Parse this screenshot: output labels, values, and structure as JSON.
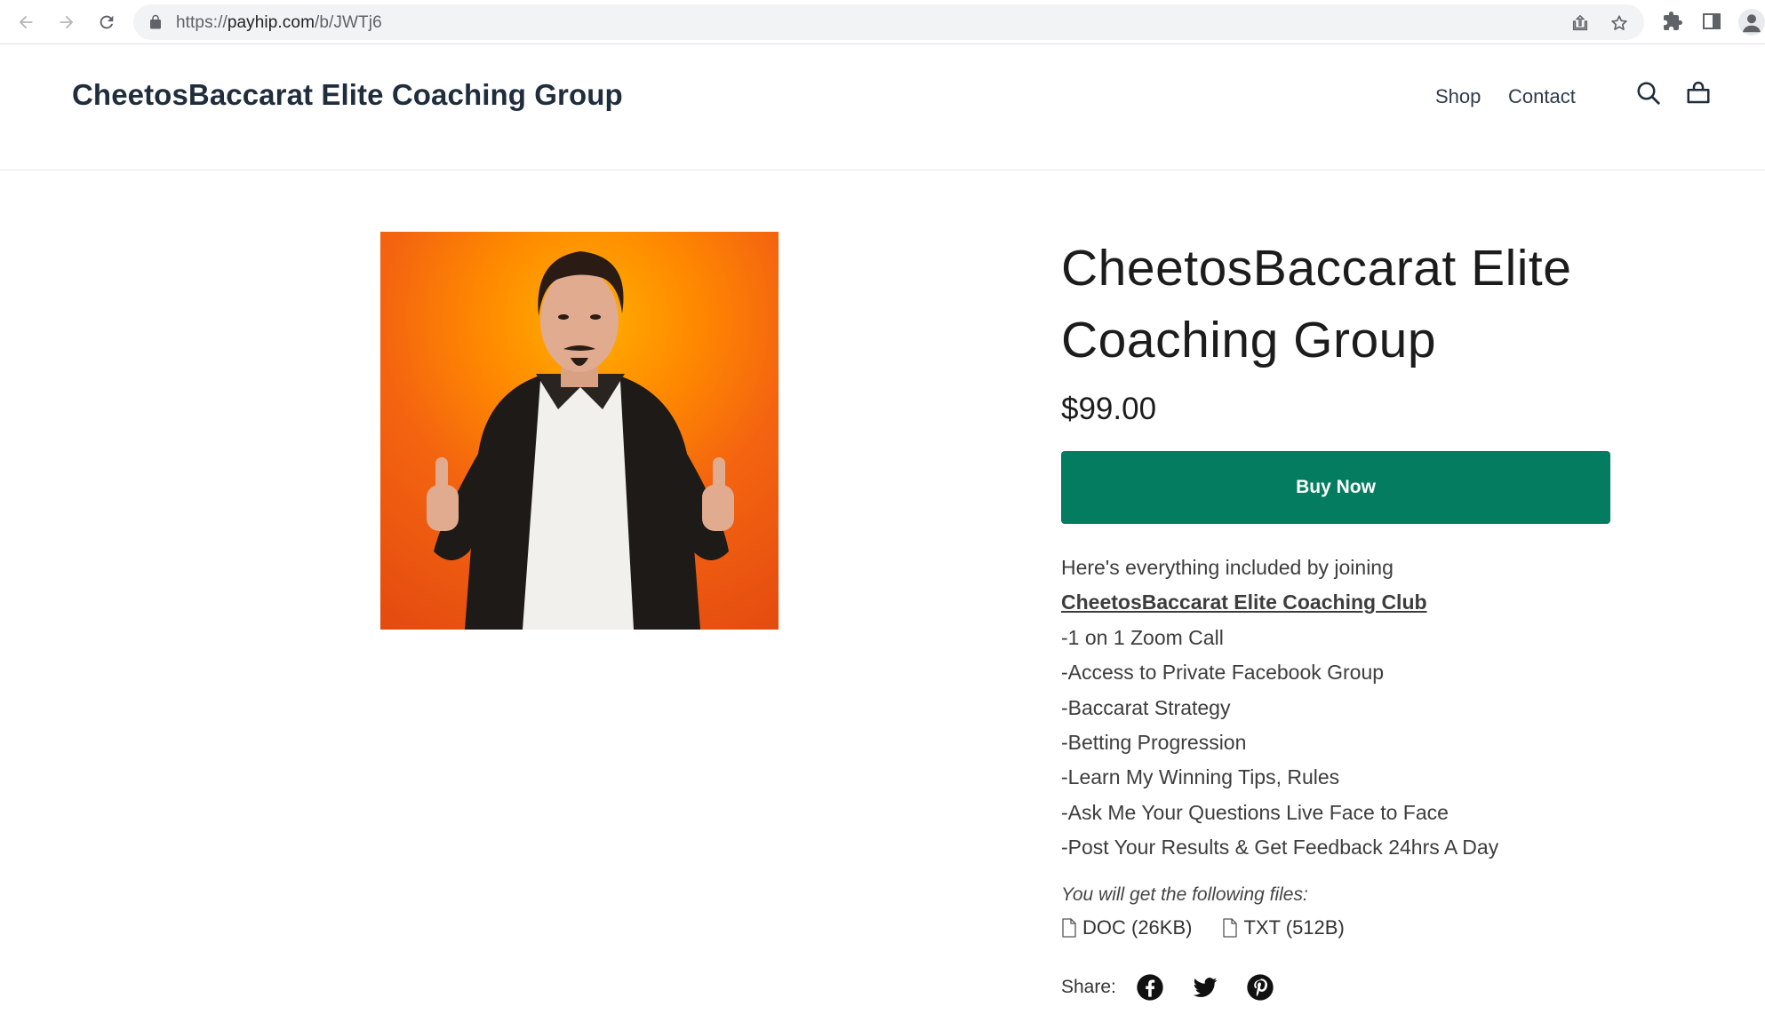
{
  "browser": {
    "url_scheme": "https://",
    "url_host": "payhip.com",
    "url_path": "/b/JWTj6",
    "icons": [
      "back-arrow-icon",
      "forward-arrow-icon",
      "reload-icon",
      "lock-icon",
      "share-page-icon",
      "bookmark-star-icon",
      "extensions-icon",
      "side-panel-icon",
      "profile-icon"
    ]
  },
  "header": {
    "brand": "CheetosBaccarat Elite Coaching Group",
    "menu": [
      {
        "label": "Shop"
      },
      {
        "label": "Contact"
      }
    ],
    "icons": [
      "search-icon",
      "cart-icon"
    ]
  },
  "product": {
    "image_alt": "Product image of man giving two thumbs up on orange background",
    "title_line1": "CheetosBaccarat Elite",
    "title_line2": "Coaching Group",
    "price": "$99.00",
    "buy_label": "Buy Now",
    "description": {
      "intro": "Here's everything included by joining",
      "club_link": "CheetosBaccarat Elite Coaching Club",
      "items": [
        "-1 on 1 Zoom Call",
        "-Access to Private Facebook Group",
        "-Baccarat Strategy",
        "-Betting Progression",
        "-Learn My Winning Tips, Rules",
        "-Ask Me Your Questions Live Face to Face",
        "-Post Your Results & Get Feedback 24hrs A Day"
      ]
    },
    "files_intro": "You will get the following files:",
    "files": [
      {
        "label": "DOC (26KB)",
        "icon": "file-icon"
      },
      {
        "label": "TXT (512B)",
        "icon": "file-icon"
      }
    ],
    "share_label": "Share:",
    "share_icons": [
      "facebook-icon",
      "twitter-icon",
      "pinterest-icon"
    ]
  },
  "colors": {
    "buy_button": "#047c60",
    "brand_text": "#1f2d3d",
    "image_background": "#f46410"
  }
}
